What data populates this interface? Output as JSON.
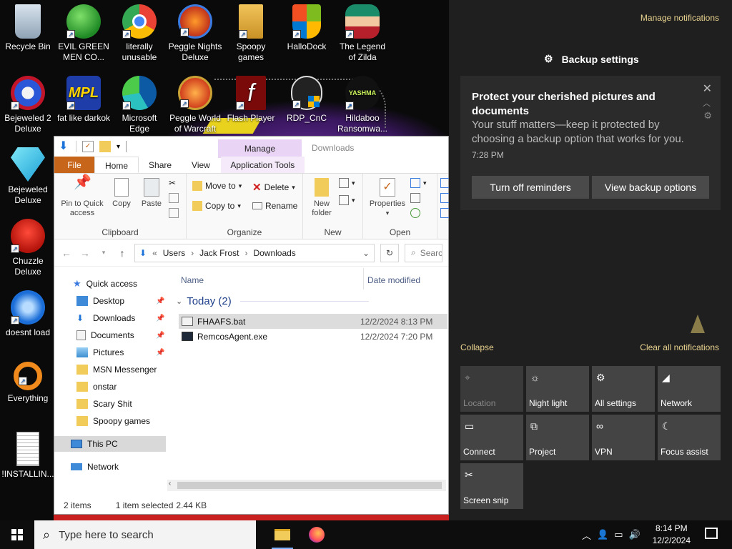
{
  "desktop": {
    "icons": [
      {
        "label": "Recycle Bin",
        "icon": "recycle-bin-icon"
      },
      {
        "label": "EVIL GREEN MEN CO...",
        "icon": "messenger-icon"
      },
      {
        "label": "literally unusable",
        "icon": "chrome-icon"
      },
      {
        "label": "Peggle Nights Deluxe",
        "icon": "peggle-icon"
      },
      {
        "label": "Spoopy games",
        "icon": "folder-icon"
      },
      {
        "label": "HalloDock",
        "icon": "windows-logo-icon"
      },
      {
        "label": "The Legend of Zilda",
        "icon": "game-character-icon"
      },
      {
        "label": "Bejeweled 2 Deluxe",
        "icon": "bejeweled2-icon"
      },
      {
        "label": "fat like darkok",
        "icon": "mpl-icon"
      },
      {
        "label": "Microsoft Edge",
        "icon": "edge-icon"
      },
      {
        "label": "Peggle World of Warcraft",
        "icon": "peggle-icon"
      },
      {
        "label": "Flash Player",
        "icon": "flash-icon"
      },
      {
        "label": "RDP_CnC",
        "icon": "rdp-icon"
      },
      {
        "label": "Hildaboo Ransomwa...",
        "icon": "yashma-icon"
      },
      {
        "label": "Bejeweled Deluxe",
        "icon": "diamond-icon"
      },
      {
        "label": "Chuzzle Deluxe",
        "icon": "chuzzle-icon"
      },
      {
        "label": "doesnt load",
        "icon": "thunderbird-icon"
      },
      {
        "label": "Everything",
        "icon": "everything-search-icon"
      },
      {
        "label": "!INSTALLIN...",
        "icon": "text-file-icon"
      }
    ]
  },
  "explorer": {
    "title_context_tab": "Manage",
    "window_title": "Downloads",
    "tabs": [
      "File",
      "Home",
      "Share",
      "View",
      "Application Tools"
    ],
    "ribbon": {
      "pin_label": "Pin to Quick access",
      "copy_label": "Copy",
      "paste_label": "Paste",
      "clipboard_group": "Clipboard",
      "move_to": "Move to",
      "copy_to": "Copy to",
      "delete": "Delete",
      "rename": "Rename",
      "organize_group": "Organize",
      "new_folder": "New folder",
      "new_group": "New",
      "properties": "Properties",
      "open_group": "Open"
    },
    "address": {
      "crumbs": [
        "Users",
        "Jack Frost",
        "Downloads"
      ],
      "search_placeholder": "Search"
    },
    "nav": {
      "quick_access": "Quick access",
      "items": [
        "Desktop",
        "Downloads",
        "Documents",
        "Pictures",
        "MSN Messenger",
        "onstar",
        "Scary Shit",
        "Spoopy games"
      ],
      "this_pc": "This PC",
      "network": "Network"
    },
    "columns": {
      "name": "Name",
      "date": "Date modified"
    },
    "group": "Today (2)",
    "files": [
      {
        "name": "FHAAFS.bat",
        "date": "12/2/2024 8:13 PM"
      },
      {
        "name": "RemcosAgent.exe",
        "date": "12/2/2024 7:20 PM"
      }
    ],
    "status": {
      "count": "2 items",
      "selected": "1 item selected",
      "size": "2.44 KB"
    }
  },
  "action_center": {
    "manage": "Manage notifications",
    "app_header": "Backup settings",
    "toast": {
      "title": "Protect your cherished pictures and documents",
      "message": "Your stuff matters—keep it protected by choosing a backup option that works for you.",
      "time": "7:28 PM",
      "btn_off": "Turn off reminders",
      "btn_view": "View backup options"
    },
    "collapse": "Collapse",
    "clear_all": "Clear all notifications",
    "quick_actions": [
      {
        "label": "Location",
        "icon": "location-icon",
        "enabled": false
      },
      {
        "label": "Night light",
        "icon": "night-light-icon",
        "enabled": true
      },
      {
        "label": "All settings",
        "icon": "settings-icon",
        "enabled": true
      },
      {
        "label": "Network",
        "icon": "network-icon",
        "enabled": true
      },
      {
        "label": "Connect",
        "icon": "connect-icon",
        "enabled": true
      },
      {
        "label": "Project",
        "icon": "project-icon",
        "enabled": true
      },
      {
        "label": "VPN",
        "icon": "vpn-icon",
        "enabled": true
      },
      {
        "label": "Focus assist",
        "icon": "focus-assist-icon",
        "enabled": true
      },
      {
        "label": "Screen snip",
        "icon": "screen-snip-icon",
        "enabled": true
      }
    ]
  },
  "taskbar": {
    "search_placeholder": "Type here to search",
    "time": "8:14 PM",
    "date": "12/2/2024"
  }
}
